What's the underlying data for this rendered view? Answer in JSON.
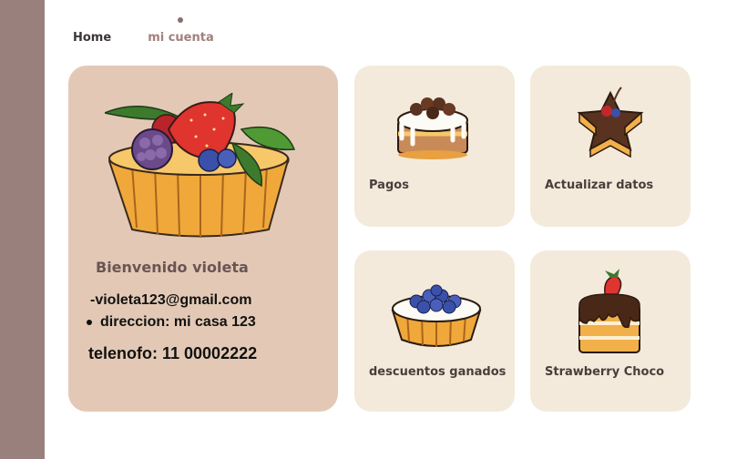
{
  "nav": {
    "home_label": "Home",
    "account_label": "mi cuenta"
  },
  "profile": {
    "welcome": "Bienvenido violeta",
    "email": "-violeta123@gmail.com",
    "address": "direccion: mi casa 123",
    "phone": "telenofo: 11 00002222",
    "illustration": "fruit-tart-icon"
  },
  "tiles": [
    {
      "label": "Pagos",
      "icon": "chocolate-cake-icon"
    },
    {
      "label": "Actualizar datos",
      "icon": "star-cake-icon"
    },
    {
      "label": "descuentos ganados",
      "icon": "blueberry-tart-icon"
    },
    {
      "label": "Strawberry Choco",
      "icon": "strawberry-choco-cake-icon"
    }
  ],
  "colors": {
    "sidebar": "#9a807d",
    "profile_card": "#e3c9b5",
    "tile": "#f3eadb",
    "accent_text": "#a2807d"
  }
}
